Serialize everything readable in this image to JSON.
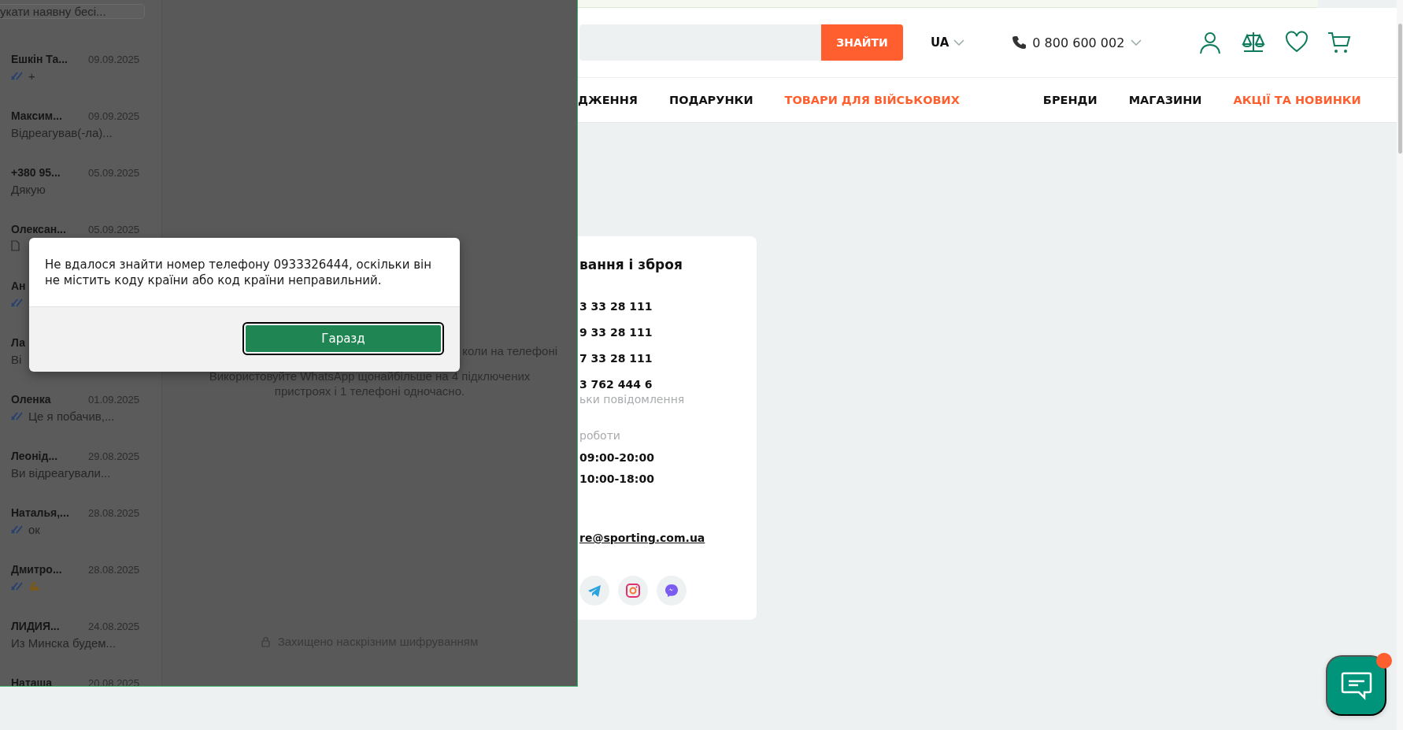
{
  "whatsapp": {
    "search": {
      "placeholder": "укати наявну бесі..."
    },
    "chats": [
      {
        "kind": "text",
        "name": "Ешкін Та...",
        "date": "09.09.2025",
        "preview": "+",
        "ticks": true
      },
      {
        "kind": "text",
        "name": "Максим...",
        "date": "09.09.2025",
        "preview": "Відреагував(-ла)...",
        "ticks": false
      },
      {
        "kind": "text",
        "name": "+380 95...",
        "date": "05.09.2025",
        "preview": "Дякую",
        "ticks": false
      },
      {
        "kind": "document",
        "name": "Олексан...",
        "date": "05.09.2025",
        "ticks": false
      },
      {
        "kind": "text",
        "name": "Ан",
        "ticks": true
      },
      {
        "kind": "text",
        "name": "Ла",
        "preview": "Ві",
        "ticks": false
      },
      {
        "kind": "text",
        "name": "Оленка",
        "date": "01.09.2025",
        "preview": "Це я побачив,...",
        "ticks": true
      },
      {
        "kind": "text",
        "name": "Леонід...",
        "date": "29.08.2025",
        "preview": "Ви відреагували...",
        "ticks": false
      },
      {
        "kind": "text",
        "name": "Наталья,...",
        "date": "28.08.2025",
        "preview": "ок",
        "ticks": true
      },
      {
        "kind": "emoji",
        "name": "Дмитро...",
        "date": "28.08.2025",
        "ticks": true
      },
      {
        "kind": "text",
        "name": "ЛИДИЯ...",
        "date": "24.08.2025",
        "preview": "Из Минска будем...",
        "ticks": false
      },
      {
        "kind": "text",
        "name": "Наташа",
        "date": "20.08.2025",
        "ticks": false
      }
    ],
    "info": {
      "partial_line": "коли на телефоні",
      "text": "Використовуйте WhatsApp щонайбільше на 4 підключених пристроях і 1 телефоні одночасно."
    },
    "footer": "Захищено наскрізним шифруванням"
  },
  "dialog": {
    "message": "Не вдалося знайти номер телефону 0933326444, оскільки він не містить коду країни або код країни неправильний.",
    "button": "Гаразд"
  },
  "site": {
    "search_button": "ЗНАЙТИ",
    "language": "UA",
    "phone": "0 800 600 002",
    "nav": [
      {
        "label": "ДЖЕННЯ",
        "highlight": false
      },
      {
        "label": "ПОДАРУНКИ",
        "highlight": false
      },
      {
        "label": "ТОВАРИ ДЛЯ ВІЙСЬКОВИХ",
        "highlight": true
      },
      {
        "label": "БРЕНДИ",
        "highlight": false
      },
      {
        "label": "МАГАЗИНИ",
        "highlight": false
      },
      {
        "label": "АКЦІЇ ТА НОВИНКИ",
        "highlight": true
      }
    ],
    "contact_card": {
      "title": "вання і зброя",
      "phones": [
        "3 33 28 111",
        "9 33 28 111",
        "7 33 28 111",
        "3 762 444 6"
      ],
      "phone_note": "ьки повідомлення",
      "hours_label": "роботи",
      "hours": [
        "09:00-20:00",
        "10:00-18:00"
      ],
      "email": "re@sporting.com.ua",
      "socials": [
        {
          "kind": "telegram"
        },
        {
          "kind": "instagram"
        },
        {
          "kind": "messenger"
        }
      ]
    },
    "chat_widget": {
      "unread": true
    }
  }
}
